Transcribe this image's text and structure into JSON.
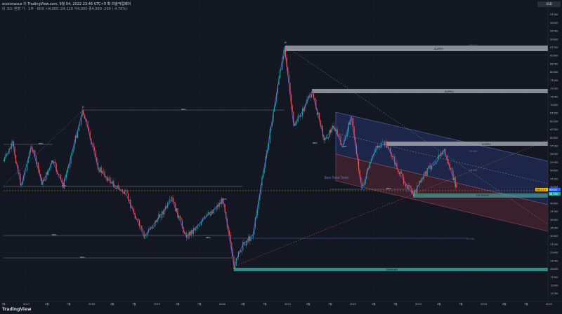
{
  "header": {
    "line1": "ecoronasus 이 TradingView.com, 9월 04, 2022 23:46 UTC+9 확 미술작업페이",
    "line2": "비 코드 분할 가 · 1주 · KRX  시4,000  고4,110  저4,000  종4,000  -200 (-4.76%)"
  },
  "price_badge": "USD",
  "logo": "TradingView",
  "chart_data": {
    "type": "line",
    "title": "",
    "xlabel": "",
    "ylabel": "",
    "x_ticks": [
      "7월",
      "2017",
      "4월",
      "7월",
      "2018",
      "4월",
      "7월",
      "2019",
      "4월",
      "7월",
      "2020",
      "4월",
      "7월",
      "2021",
      "4월",
      "7월",
      "2022",
      "4월",
      "7월",
      "2023",
      "4월",
      "7월",
      "2024",
      "4월",
      "7월",
      "2025"
    ],
    "y_ticks": [
      "97500",
      "95000",
      "92500",
      "90000",
      "87500",
      "85000",
      "82500",
      "80000",
      "77500",
      "75000",
      "72500",
      "70000",
      "67500",
      "65000",
      "62500",
      "60000",
      "57500",
      "55000",
      "52500",
      "50000",
      "47500",
      "45000",
      "42500",
      "40000",
      "37500",
      "35000",
      "32500",
      "30000",
      "27500",
      "25000",
      "22500",
      "20000",
      "17500",
      "15000",
      "12500"
    ],
    "ylim": [
      11000,
      99000
    ],
    "grid": true,
    "current_price": "40000",
    "price_labels": [
      {
        "text": "39813.3",
        "color": "#f0b90b"
      },
      {
        "text": "40000",
        "color": "#2962ff"
      },
      {
        "text": "38 750",
        "color": "#26a69a"
      }
    ],
    "zones": [
      {
        "label": "SUPPLY",
        "value_label": "86000"
      },
      {
        "label": "SUPPLY",
        "value_label": ""
      },
      {
        "label": "SUPPLY",
        "value_label": "55500"
      },
      {
        "label": "DEMAND",
        "value_label": "16500"
      },
      {
        "label": "OB Bullish",
        "value_label": "35500"
      }
    ],
    "fib_labels": [
      "88%",
      "86%",
      "88%",
      "88%",
      "66%",
      "68%",
      "86%",
      "88%",
      "86%",
      "86%",
      "86%",
      "86%",
      "86%",
      "88%",
      "88%"
    ],
    "wave_labels": [
      "H",
      "L",
      "H",
      "L",
      "H",
      "L",
      "H",
      "L",
      "H",
      "L",
      "H"
    ],
    "annotations": [
      "Bear Trend Trend",
      "32233",
      "54500"
    ],
    "close_series": {
      "name": "Price",
      "values": [
        54,
        48,
        50,
        44,
        52,
        57,
        53,
        47,
        49,
        45,
        51,
        56,
        52,
        46,
        50,
        54,
        58,
        55,
        50,
        56,
        61,
        64,
        60,
        57,
        66,
        68,
        62,
        55,
        52,
        48,
        46,
        44,
        41,
        38,
        42,
        36,
        33,
        31,
        28,
        30,
        27,
        24,
        30,
        26,
        23,
        25,
        28,
        30,
        26,
        29,
        32,
        27,
        29,
        30,
        27,
        24,
        22,
        18,
        20,
        16,
        21,
        19,
        24,
        26,
        29,
        34,
        38,
        46,
        52,
        62,
        72,
        78,
        68,
        74,
        70,
        66,
        62,
        68,
        64,
        60,
        56,
        62,
        58,
        66,
        60,
        54,
        50,
        46,
        55,
        50,
        52,
        48,
        46,
        49,
        53,
        50,
        45,
        49,
        52,
        46,
        44,
        48,
        47,
        43,
        40,
        39,
        40
      ]
    }
  }
}
